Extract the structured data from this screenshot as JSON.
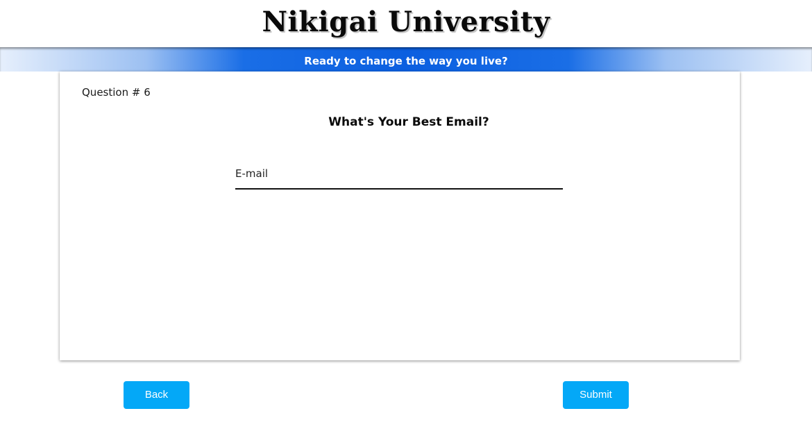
{
  "header": {
    "title": "Nikigai University",
    "tagline": "Ready to change the way you live?"
  },
  "question": {
    "number_label": "Question # 6",
    "prompt": "What's Your Best Email?",
    "email_placeholder": "E-mail",
    "email_value": ""
  },
  "actions": {
    "back_label": "Back",
    "submit_label": "Submit"
  },
  "colors": {
    "accent_button": "#04a8f7",
    "banner_blue": "#0b5fe0"
  }
}
